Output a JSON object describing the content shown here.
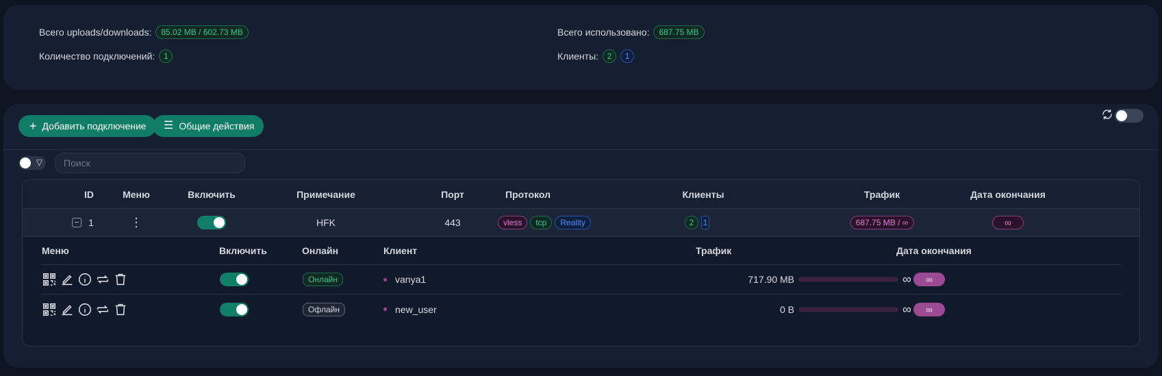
{
  "stats": {
    "total_updown_label": "Всего uploads/downloads:",
    "total_updown_value": "85.02 MB / 602.73 MB",
    "connections_label": "Количество подключений:",
    "connections_value": "1",
    "total_used_label": "Всего использовано:",
    "total_used_value": "687.75 MB",
    "clients_label": "Клиенты:",
    "clients_total": "2",
    "clients_online": "1"
  },
  "toolbar": {
    "add_label": "Добавить подключение",
    "general_actions_label": "Общие действия",
    "add_icon": "plus-icon",
    "actions_icon": "menu-icon",
    "refresh_icon": "refresh-icon"
  },
  "filter": {
    "search_placeholder": "Поиск",
    "filter_icon": "filter-icon"
  },
  "table": {
    "headers": {
      "id": "ID",
      "menu": "Меню",
      "enable": "Включить",
      "remark": "Примечание",
      "port": "Порт",
      "protocol": "Протокол",
      "clients": "Клиенты",
      "traffic": "Трафик",
      "expiry": "Дата окончания"
    },
    "rows": [
      {
        "id": "1",
        "expand_symbol": "−",
        "menu_symbol": "⋮",
        "enabled": true,
        "remark": "HFK",
        "port": "443",
        "protocol_tags": [
          "vless",
          "tcp",
          "Reality"
        ],
        "clients_total": "2",
        "clients_online": "1",
        "traffic": "687.75 MB / ∞",
        "expiry": "∞"
      }
    ]
  },
  "clients_table": {
    "headers": {
      "menu": "Меню",
      "enable": "Включить",
      "online": "Онлайн",
      "client": "Клиент",
      "traffic": "Трафик",
      "expiry": "Дата окончания"
    },
    "rows": [
      {
        "enabled": true,
        "online": "Онлайн",
        "is_online": true,
        "client": "vanya1",
        "traffic": "717.90 MB",
        "traffic_fraction": 1.0,
        "limit": "∞",
        "expiry": "∞"
      },
      {
        "enabled": true,
        "online": "Офлайн",
        "is_online": false,
        "client": "new_user",
        "traffic": "0 B",
        "traffic_fraction": 1.0,
        "limit": "∞",
        "expiry": "∞"
      }
    ],
    "menu_icons": [
      "qr-code-icon",
      "edit-icon",
      "info-icon",
      "reset-traffic-icon",
      "delete-icon"
    ]
  },
  "colors": {
    "accent": "#0f7d66",
    "online": "#37c58d",
    "blue": "#4f8dff",
    "traffic": "#a0468f"
  }
}
